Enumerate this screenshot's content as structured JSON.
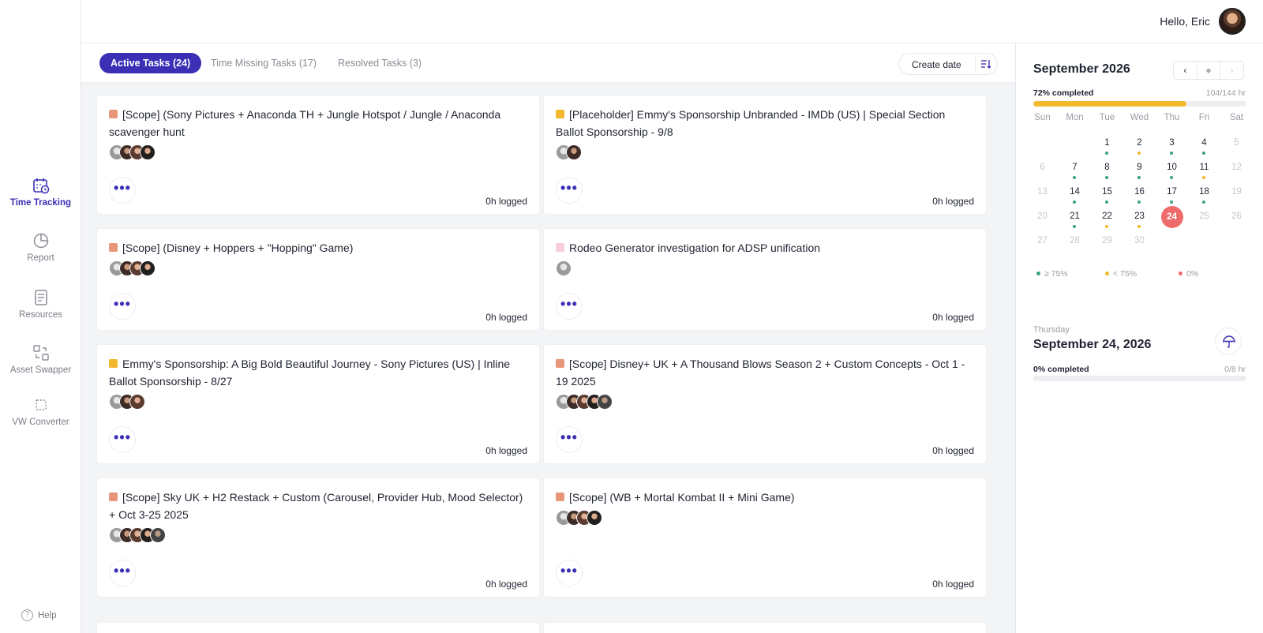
{
  "colors": {
    "accent": "#3b2fb5",
    "progress": "#f2b92e",
    "today": "#ef6b6b",
    "dot_high": "#3aa27a",
    "dot_low": "#f2b92e",
    "dot_zero": "#ef6b6b"
  },
  "sidebar": {
    "items": [
      {
        "label": "Time Tracking",
        "icon": "calendar-clock-icon",
        "active": true
      },
      {
        "label": "Report",
        "icon": "pie-chart-icon",
        "active": false
      },
      {
        "label": "Resources",
        "icon": "document-icon",
        "active": false
      },
      {
        "label": "Asset Swapper",
        "icon": "swap-icon",
        "active": false
      },
      {
        "label": "VW Converter",
        "icon": "dashed-box-icon",
        "active": false
      }
    ],
    "help_label": "Help"
  },
  "header": {
    "greeting": "Hello, Eric"
  },
  "tabs": [
    {
      "label": "Active Tasks (24)",
      "active": true
    },
    {
      "label": "Time Missing Tasks (17)",
      "active": false
    },
    {
      "label": "Resolved Tasks (3)",
      "active": false
    }
  ],
  "sort": {
    "label": "Create date"
  },
  "cards": [
    {
      "title": "[Scope] (Sony Pictures + Anaconda TH + Jungle Hotspot / Jungle / Anaconda scavenger hunt",
      "tag_color": "#e8967a",
      "avatar_count": 4,
      "logged": "0h logged"
    },
    {
      "title": "[Placeholder] Emmy's Sponsorship Unbranded - IMDb (US) | Special Section Ballot Sponsorship - 9/8",
      "tag_color": "#f2b92e",
      "avatar_count": 2,
      "logged": "0h logged"
    },
    {
      "title": "[Scope] (Disney + Hoppers + \"Hopping\" Game)",
      "tag_color": "#e8967a",
      "avatar_count": 4,
      "logged": "0h logged"
    },
    {
      "title": "Rodeo Generator investigation for ADSP unification",
      "tag_color": "#f8cfd8",
      "avatar_count": 1,
      "logged": "0h logged"
    },
    {
      "title": "Emmy's Sponsorship: A Big Bold Beautiful Journey - Sony Pictures (US) | Inline Ballot Sponsorship - 8/27",
      "tag_color": "#f2b92e",
      "avatar_count": 3,
      "logged": "0h logged"
    },
    {
      "title": "[Scope] Disney+ UK + A Thousand Blows Season 2 + Custom Concepts - Oct 1 - 19 2025",
      "tag_color": "#e8967a",
      "avatar_count": 5,
      "logged": "0h logged"
    },
    {
      "title": "[Scope] Sky UK + H2 Restack + Custom (Carousel, Provider Hub, Mood Selector) + Oct 3-25 2025",
      "tag_color": "#e8967a",
      "avatar_count": 5,
      "logged": "0h logged"
    },
    {
      "title": "[Scope] (WB + Mortal Kombat II + Mini Game)",
      "tag_color": "#e8967a",
      "avatar_count": 4,
      "logged": "0h logged"
    }
  ],
  "calendar": {
    "month_title": "September 2026",
    "nav": {
      "prev": "‹",
      "today": "◆",
      "next": "›"
    },
    "completion_label": "72% completed",
    "completion_value": "104/144 hr",
    "completion_fraction": 0.72,
    "weekdays": [
      "Sun",
      "Mon",
      "Tue",
      "Wed",
      "Thu",
      "Fri",
      "Sat"
    ],
    "weeks": [
      [
        {
          "d": ""
        },
        {
          "d": ""
        },
        {
          "d": "1",
          "dot": "high"
        },
        {
          "d": "2",
          "dot": "low"
        },
        {
          "d": "3",
          "dot": "high"
        },
        {
          "d": "4",
          "dot": "high"
        },
        {
          "d": "5",
          "muted": true
        }
      ],
      [
        {
          "d": "6",
          "muted": true
        },
        {
          "d": "7",
          "dot": "high"
        },
        {
          "d": "8",
          "dot": "high"
        },
        {
          "d": "9",
          "dot": "high"
        },
        {
          "d": "10",
          "dot": "high"
        },
        {
          "d": "11",
          "dot": "low"
        },
        {
          "d": "12",
          "muted": true
        }
      ],
      [
        {
          "d": "13",
          "muted": true
        },
        {
          "d": "14",
          "dot": "high"
        },
        {
          "d": "15",
          "dot": "high"
        },
        {
          "d": "16",
          "dot": "high"
        },
        {
          "d": "17",
          "dot": "high"
        },
        {
          "d": "18",
          "dot": "high"
        },
        {
          "d": "19",
          "muted": true
        }
      ],
      [
        {
          "d": "20",
          "muted": true
        },
        {
          "d": "21",
          "dot": "high"
        },
        {
          "d": "22",
          "dot": "low"
        },
        {
          "d": "23",
          "dot": "low"
        },
        {
          "d": "24",
          "today": true
        },
        {
          "d": "25",
          "muted": true
        },
        {
          "d": "26",
          "muted": true
        }
      ],
      [
        {
          "d": "27",
          "muted": true
        },
        {
          "d": "28",
          "muted": true
        },
        {
          "d": "29",
          "muted": true
        },
        {
          "d": "30",
          "muted": true
        },
        {
          "d": ""
        },
        {
          "d": ""
        },
        {
          "d": ""
        }
      ]
    ],
    "legend": [
      {
        "label": "≥ 75%",
        "color": "#3aa27a"
      },
      {
        "label": "< 75%",
        "color": "#f2b92e"
      },
      {
        "label": "0%",
        "color": "#ef6b6b"
      }
    ]
  },
  "day_detail": {
    "weekday": "Thursday",
    "date": "September 24, 2026",
    "completion_label": "0% completed",
    "completion_value": "0/8 hr",
    "completion_fraction": 0
  }
}
